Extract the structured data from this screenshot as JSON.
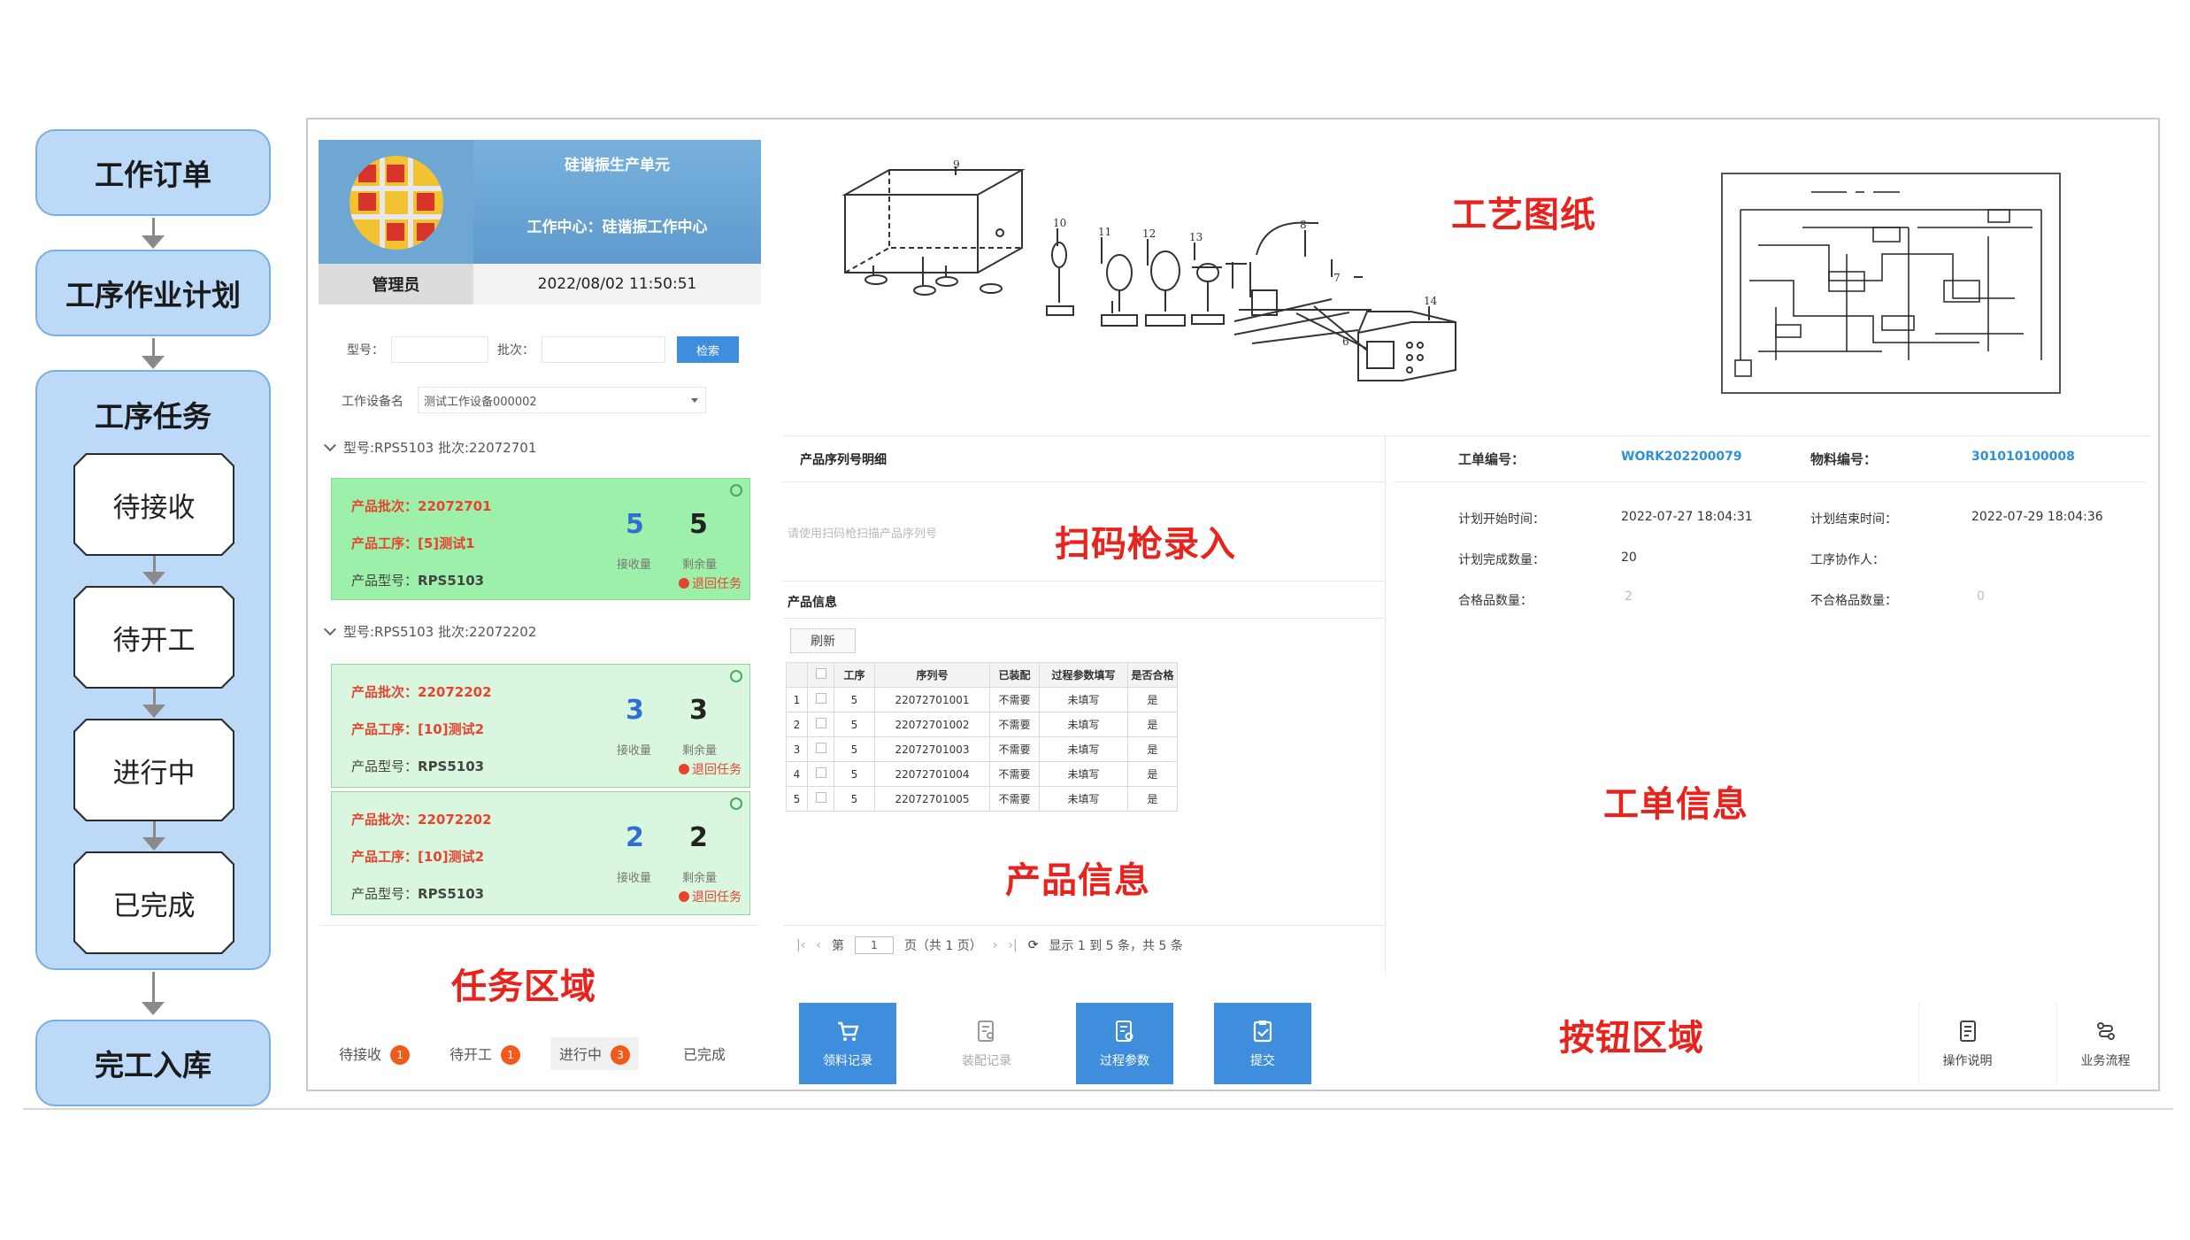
{
  "flow": {
    "order": "工作订单",
    "plan": "工序作业计划",
    "task_group": "工序任务",
    "steps": [
      "待接收",
      "待开工",
      "进行中",
      "已完成"
    ],
    "finish": "完工入库"
  },
  "header": {
    "title": "硅谐振生产单元",
    "work_center": "工作中心：硅谐振工作中心",
    "role": "管理员",
    "datetime": "2022/08/02 11:50:51"
  },
  "filter": {
    "model_label": "型号：",
    "batch_label": "批次：",
    "search_label": "检索",
    "device_label": "工作设备名",
    "device_value": "测试工作设备000002"
  },
  "task_groups": [
    {
      "header": "型号:RPS5103 批次:22072701",
      "cards": [
        {
          "batch_label": "产品批次：",
          "batch": "22072701",
          "proc_label": "产品工序：",
          "proc": "[5]测试1",
          "model_label": "产品型号：",
          "model": "RPS5103",
          "received": "5",
          "remaining": "5",
          "received_label": "接收量",
          "remaining_label": "剩余量",
          "return_label": "退回任务"
        }
      ]
    },
    {
      "header": "型号:RPS5103 批次:22072202",
      "cards": [
        {
          "batch_label": "产品批次：",
          "batch": "22072202",
          "proc_label": "产品工序：",
          "proc": "[10]测试2",
          "model_label": "产品型号：",
          "model": "RPS5103",
          "received": "3",
          "remaining": "3",
          "received_label": "接收量",
          "remaining_label": "剩余量",
          "return_label": "退回任务"
        },
        {
          "batch_label": "产品批次：",
          "batch": "22072202",
          "proc_label": "产品工序：",
          "proc": "[10]测试2",
          "model_label": "产品型号：",
          "model": "RPS5103",
          "received": "2",
          "remaining": "2",
          "received_label": "接收量",
          "remaining_label": "剩余量",
          "return_label": "退回任务"
        }
      ]
    }
  ],
  "tabs": [
    {
      "label": "待接收",
      "count": "1"
    },
    {
      "label": "待开工",
      "count": "1"
    },
    {
      "label": "进行中",
      "count": "3"
    },
    {
      "label": "已完成",
      "count": ""
    }
  ],
  "notes": {
    "task_area": "任务区域",
    "drawing": "工艺图纸",
    "scanner": "扫码枪录入",
    "product_info": "产品信息",
    "order_info": "工单信息",
    "button_area": "按钮区域"
  },
  "drawing_numbers": [
    "9",
    "10",
    "11",
    "12",
    "13",
    "8",
    "7",
    "6",
    "14"
  ],
  "serial": {
    "title": "产品序列号明细",
    "placeholder": "请使用扫码枪扫描产品序列号"
  },
  "product": {
    "title": "产品信息",
    "refresh": "刷新",
    "columns": [
      "工序",
      "序列号",
      "已装配",
      "过程参数填写",
      "是否合格"
    ],
    "rows": [
      [
        "1",
        "5",
        "22072701001",
        "不需要",
        "未填写",
        "是"
      ],
      [
        "2",
        "5",
        "22072701002",
        "不需要",
        "未填写",
        "是"
      ],
      [
        "3",
        "5",
        "22072701003",
        "不需要",
        "未填写",
        "是"
      ],
      [
        "4",
        "5",
        "22072701004",
        "不需要",
        "未填写",
        "是"
      ],
      [
        "5",
        "5",
        "22072701005",
        "不需要",
        "未填写",
        "是"
      ]
    ],
    "pager": {
      "page_prefix": "第",
      "page": "1",
      "page_suffix": "页（共 1 页）",
      "summary": "显示 1 到 5 条，共 5 条"
    }
  },
  "order": {
    "no_label": "工单编号：",
    "no": "WORK202200079",
    "material_label": "物料编号：",
    "material": "301010100008",
    "plan_start_label": "计划开始时间：",
    "plan_start": "2022-07-27 18:04:31",
    "plan_end_label": "计划结束时间：",
    "plan_end": "2022-07-29 18:04:36",
    "plan_qty_label": "计划完成数量：",
    "plan_qty": "20",
    "worker_label": "工序协作人：",
    "worker": "",
    "ok_qty_label": "合格品数量：",
    "ok_qty": "2",
    "ng_qty_label": "不合格品数量：",
    "ng_qty": "0"
  },
  "actions": {
    "material_record": "领料记录",
    "assembly_record": "装配记录",
    "process_params": "过程参数",
    "submit": "提交",
    "manual": "操作说明",
    "flow": "业务流程"
  },
  "colors": {
    "accent": "#3f8ede",
    "card_active": "#9df0aa",
    "card": "#d9f7df",
    "alert": "#e8432f",
    "note": "#e8221c",
    "flow_fill": "#bcd9f7"
  }
}
